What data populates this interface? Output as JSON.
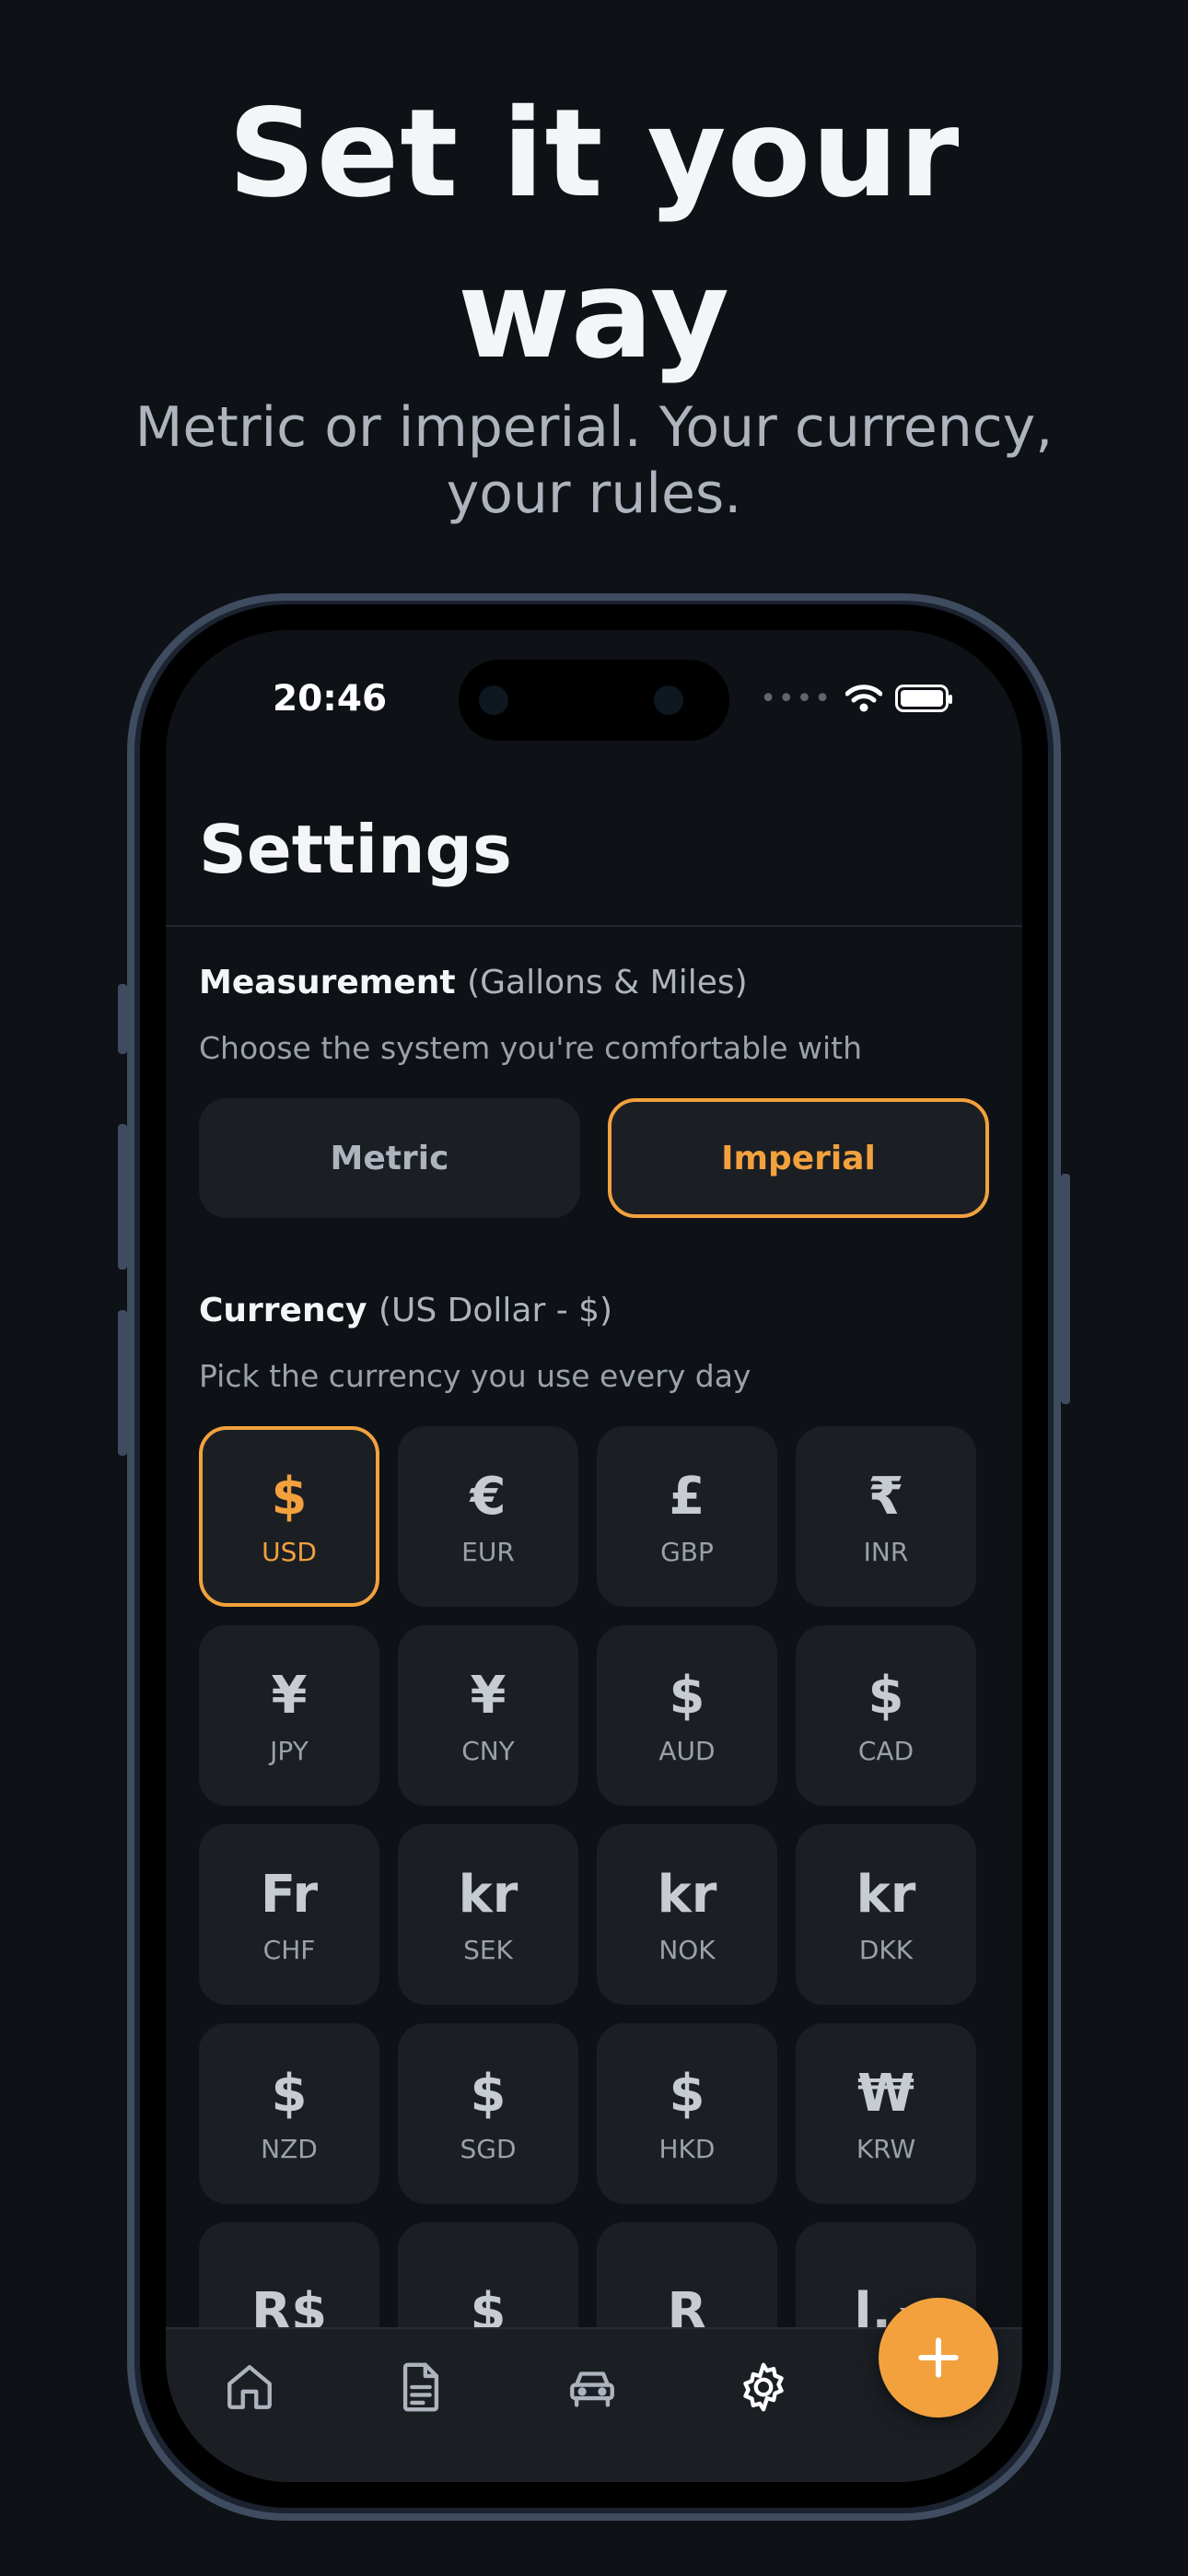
{
  "hero": {
    "headline_line1": "Set it your",
    "headline_line2": "way",
    "subline_line1": "Metric or imperial. Your currency,",
    "subline_line2": "your rules."
  },
  "status_bar": {
    "time": "20:46"
  },
  "settings": {
    "title": "Settings",
    "measurement": {
      "label": "Measurement",
      "selected_detail": "(Gallons & Miles)",
      "description": "Choose the system you're comfortable with",
      "options": [
        "Metric",
        "Imperial"
      ],
      "selected": "Imperial"
    },
    "currency": {
      "label": "Currency",
      "selected_detail": "(US Dollar - $)",
      "description": "Pick the currency you use every day",
      "selected": "USD",
      "items": [
        {
          "symbol": "$",
          "code": "USD"
        },
        {
          "symbol": "€",
          "code": "EUR"
        },
        {
          "symbol": "£",
          "code": "GBP"
        },
        {
          "symbol": "₹",
          "code": "INR"
        },
        {
          "symbol": "¥",
          "code": "JPY"
        },
        {
          "symbol": "¥",
          "code": "CNY"
        },
        {
          "symbol": "$",
          "code": "AUD"
        },
        {
          "symbol": "$",
          "code": "CAD"
        },
        {
          "symbol": "Fr",
          "code": "CHF"
        },
        {
          "symbol": "kr",
          "code": "SEK"
        },
        {
          "symbol": "kr",
          "code": "NOK"
        },
        {
          "symbol": "kr",
          "code": "DKK"
        },
        {
          "symbol": "$",
          "code": "NZD"
        },
        {
          "symbol": "$",
          "code": "SGD"
        },
        {
          "symbol": "$",
          "code": "HKD"
        },
        {
          "symbol": "₩",
          "code": "KRW"
        },
        {
          "symbol": "R$",
          "code": ""
        },
        {
          "symbol": "$",
          "code": ""
        },
        {
          "symbol": "R",
          "code": ""
        },
        {
          "symbol": "د.إ",
          "code": ""
        }
      ]
    }
  },
  "tabbar": {
    "tabs": [
      {
        "icon": "home-icon",
        "active": false
      },
      {
        "icon": "document-icon",
        "active": false
      },
      {
        "icon": "car-icon",
        "active": false
      },
      {
        "icon": "gear-icon",
        "active": true
      }
    ],
    "fab_icon": "plus-icon"
  },
  "colors": {
    "accent": "#f2a13d",
    "background": "#0e1116",
    "card": "#1b1f24"
  }
}
